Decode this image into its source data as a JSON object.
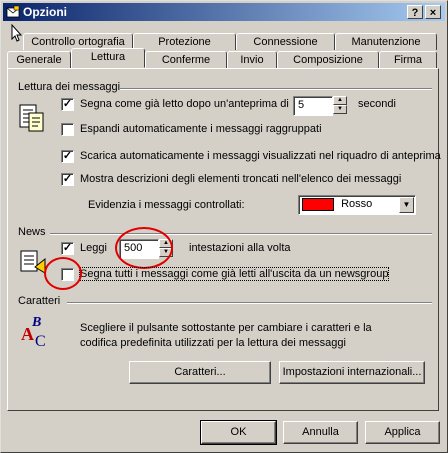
{
  "window": {
    "title": "Opzioni",
    "help_label": "?",
    "close_label": "×"
  },
  "tabs_back": [
    "Controllo ortografia",
    "Protezione",
    "Connessione",
    "Manutenzione"
  ],
  "tabs_front": [
    "Generale",
    "Lettura",
    "Conferme",
    "Invio",
    "Composizione",
    "Firma"
  ],
  "active_tab": "Lettura",
  "reading": {
    "title": "Lettura dei messaggi",
    "mark_read_label": "Segna come già letto dopo un'anteprima di",
    "mark_read_checked": true,
    "mark_read_seconds": "5",
    "seconds_label": "secondi",
    "expand_groups_label": "Espandi automaticamente i messaggi raggruppati",
    "expand_groups_checked": false,
    "download_preview_label": "Scarica automaticamente i messaggi visualizzati nel riquadro di anteprima",
    "download_preview_checked": true,
    "show_tooltips_label": "Mostra descrizioni degli elementi troncati nell'elenco dei messaggi",
    "show_tooltips_checked": true,
    "highlight_label": "Evidenzia i messaggi controllati:",
    "highlight_color_name": "Rosso",
    "highlight_color": "#ff0000"
  },
  "news": {
    "title": "News",
    "read_label": "Leggi",
    "read_checked": true,
    "read_count": "500",
    "headers_label": "intestazioni alla volta",
    "mark_all_read_label": "Segna tutti i messaggi come già letti all'uscita da un newsgroup",
    "mark_all_read_checked": false
  },
  "fonts": {
    "title": "Caratteri",
    "description": "Scegliere il pulsante sottostante per cambiare i caratteri e la codifica predefinita utilizzati per la lettura dei messaggi",
    "fonts_button": "Caratteri...",
    "intl_button": "Impostazioni internazionali..."
  },
  "footer": {
    "ok": "OK",
    "cancel": "Annulla",
    "apply": "Applica"
  },
  "colors": {
    "titlebar_start": "#0a246a",
    "titlebar_end": "#a6caf0",
    "face": "#d4d0c8",
    "annotation": "#e00000"
  }
}
